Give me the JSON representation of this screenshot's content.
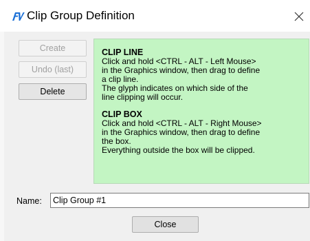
{
  "window": {
    "title": "Clip Group Definition",
    "app_icon": "fv-logo-icon",
    "close_icon": "close-icon"
  },
  "buttons": {
    "create": "Create",
    "undo": "Undo (last)",
    "delete": "Delete",
    "close": "Close"
  },
  "info": {
    "clip_line_heading": "CLIP LINE",
    "clip_line_text": "Click and hold <CTRL - ALT - Left Mouse>\nin the Graphics window, then drag to define\na clip line.\nThe glyph indicates on which side of the\nline clipping will occur.",
    "clip_box_heading": "CLIP BOX",
    "clip_box_text": "Click and hold <CTRL - ALT - Right Mouse>\nin the Graphics window, then drag to define\nthe box.\nEverything outside the box will be clipped."
  },
  "name_field": {
    "label": "Name:",
    "value": "Clip Group #1"
  },
  "colors": {
    "info_panel_bg": "#c3f5c3",
    "logo_blue": "#1a6fd6"
  }
}
